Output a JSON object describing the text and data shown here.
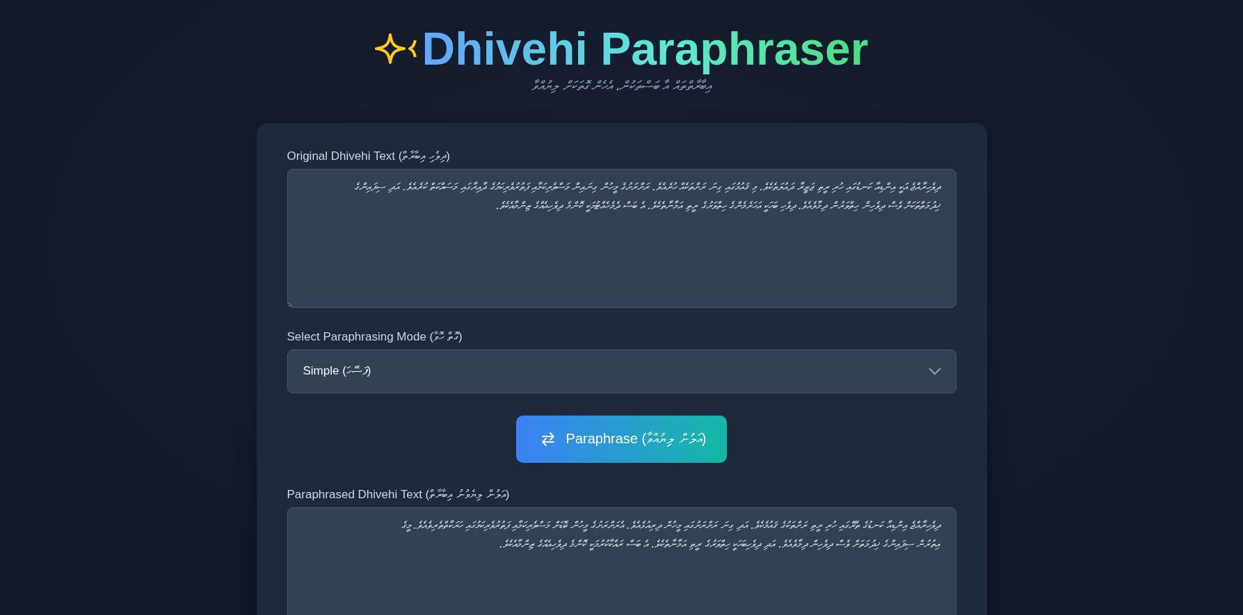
{
  "header": {
    "title": "Dhivehi Paraphraser",
    "subtitle": "އިބާރާތްތައް އާ ބަސްތަކުން، އެހެން ގޮތަކަށް ލިޔުއްވާ"
  },
  "input": {
    "label": "Original Dhivehi Text (ދިވެހި އިބާރާތް)",
    "value": "ދިވެހިރާއްޖެ އަކީ އިންޑިއާ ކަނޑުގައި ހުރި ރީތި ޖަޒީރާ ދައުލަތެކެވެ. މި ޤައުމުގައި ގިނަ ރަށްތަކެއް ހުރެއެވެ. ރަށްރަށުގެ މީހުން ގިނައިން މަސްވެރިކަމާއި ފަތުރުވެރިކަމުގެ ދާއިރާގައި މަސައްކަތް ކުރެއެވެ. އަދި ސިފައިންގެ\nޚިދުމަތްތަކަށް ވެސް ދިވެހިން ހިތްވަރުން ދިމާވެއެވެ. ދިވެހި ބަހަކީ އަހަރެމެންގެ ހިތްވަރުގެ ރީތި އަމާނާތެކެވެ. އެ ބަސް ދެމެހެއްޓުމަކީ ކޮންމެ ދިވެހިއެއްގެ ޒިންމާއެކެވެ."
  },
  "mode": {
    "label": "Select Paraphrasing Mode (ގޮތް ހޮވާ)",
    "value": "Simple (ފަސޭހަ)"
  },
  "action": {
    "label": "Paraphrase (އަލުން ލިޔުއްވާ)"
  },
  "output": {
    "label": "Paraphrased Dhivehi Text (އަލުން ލިޔެވުނު އިބާރާތް)",
    "value": "ދިވެހިރާއްޖެ އިންޑިއާ ކަނޑުގެ ތެރޭގައި ހުރި ރީތި ރަށްތަކުގެ ޤައުމެކެވެ. އަދި ގިނަ ރަށްރަށުގައި މީހުން ދިރިއުޅެއެވެ. އެރަށްރަށުގެ މީހުން ބޮޑަށް މަސްވެރިކަމާއި ފަތުރުވެރިކަމުގައި ހަރަކާތްތެރިވެއެވެ. މީގެ\nއިތުރުން ސިފައިންގެ ޚިދުމަތަށް ވެސް ދިވެހިން ދިމާވެއެވެ. އަދި ދިވެހިބަހަކީ ހިތްވަރުގެ ރީތި އަމާނާތެކެވެ. އެ ބަސް ރައްކާކުރުމަކީ ކޮންމެ ދިވެހިއެއްގެ ޒިންމާއެކެވެ."
  }
}
